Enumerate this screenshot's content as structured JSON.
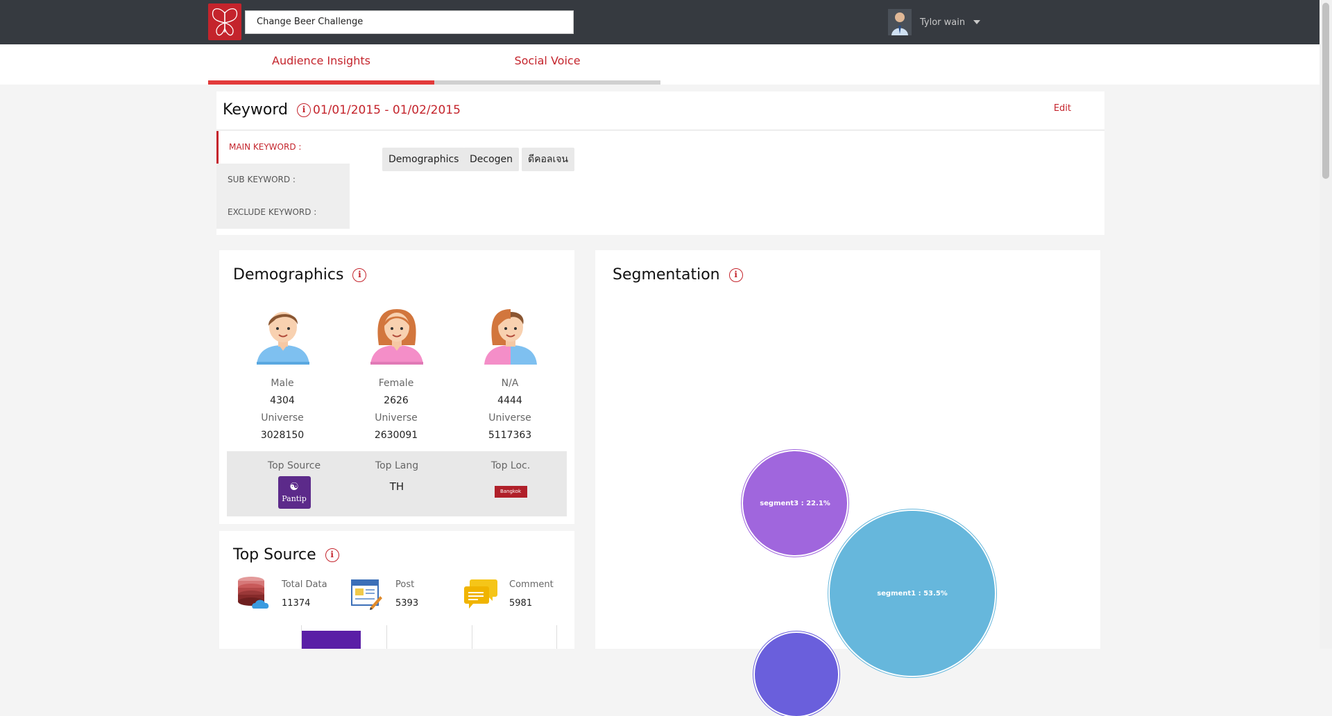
{
  "topbar": {
    "search_value": "Change Beer Challenge",
    "user_name": "Tylor wain"
  },
  "tabs": [
    {
      "label": "Audience Insights",
      "active": true
    },
    {
      "label": "Social Voice",
      "active": false
    }
  ],
  "keyword": {
    "title": "Keyword",
    "date_range": "01/01/2015 - 01/02/2015",
    "edit_label": "Edit",
    "side": [
      "MAIN KEYWORD :",
      "SUB KEYWORD :",
      "EXCLUDE KEYWORD :"
    ],
    "chips": [
      "Demographics",
      "Decogen",
      "ดีคอลเจน"
    ]
  },
  "demographics": {
    "title": "Demographics",
    "columns": [
      {
        "label": "Male",
        "count": "4304",
        "universe_label": "Universe",
        "universe": "3028150"
      },
      {
        "label": "Female",
        "count": "2626",
        "universe_label": "Universe",
        "universe": "2630091"
      },
      {
        "label": "N/A",
        "count": "4444",
        "universe_label": "Universe",
        "universe": "5117363"
      }
    ],
    "top_source_label": "Top Source",
    "top_source_logo_text": "Pantip",
    "top_lang_label": "Top Lang",
    "top_lang_value": "TH",
    "top_loc_label": "Top Loc.",
    "top_loc_value": "Bangkok"
  },
  "top_source": {
    "title": "Top Source",
    "stats": [
      {
        "label": "Total Data",
        "value": "11374",
        "icon": "database-icon"
      },
      {
        "label": "Post",
        "value": "5393",
        "icon": "post-icon"
      },
      {
        "label": "Comment",
        "value": "5981",
        "icon": "comment-icon"
      }
    ]
  },
  "segmentation": {
    "title": "Segmentation",
    "bubbles": [
      {
        "label": "segment3 : 22.1%",
        "color": "#a066dd"
      },
      {
        "label": "segment1 : 53.5%",
        "color": "#66b7dc"
      },
      {
        "label": "",
        "color": "#6a5fdc"
      }
    ]
  },
  "colors": {
    "accent": "#c4242c",
    "topbar": "#363a40"
  }
}
